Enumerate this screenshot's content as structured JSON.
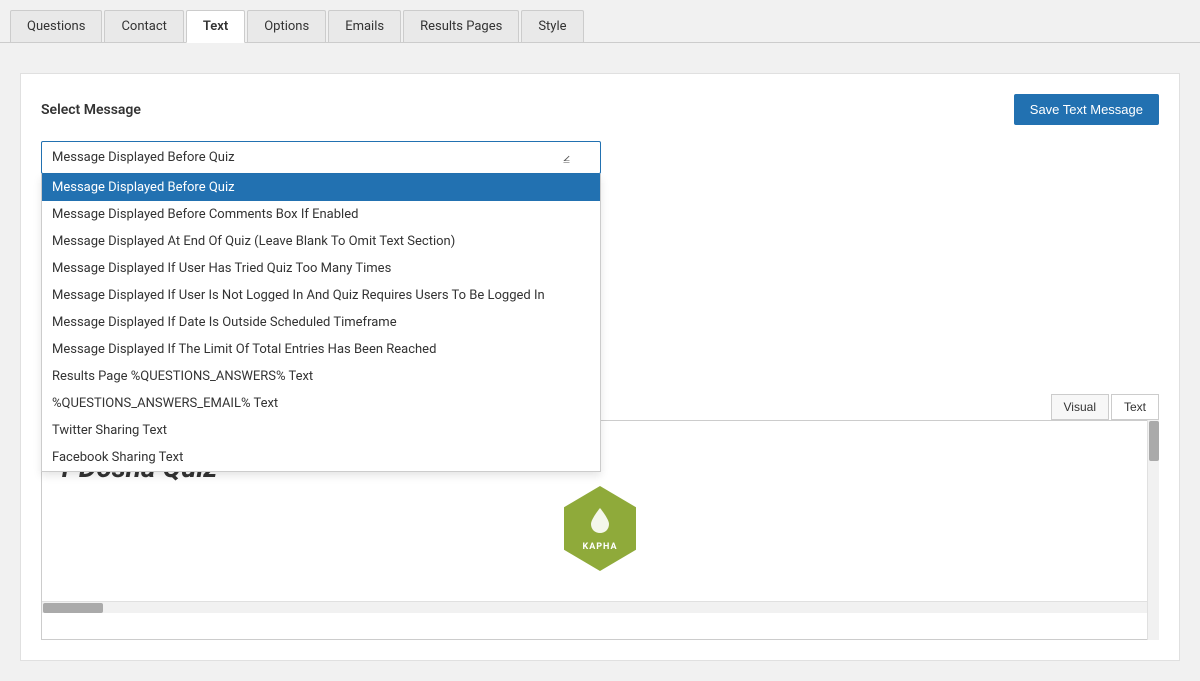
{
  "tabs": [
    {
      "id": "questions",
      "label": "Questions",
      "active": false
    },
    {
      "id": "contact",
      "label": "Contact",
      "active": false
    },
    {
      "id": "text",
      "label": "Text",
      "active": true
    },
    {
      "id": "options",
      "label": "Options",
      "active": false
    },
    {
      "id": "emails",
      "label": "Emails",
      "active": false
    },
    {
      "id": "results-pages",
      "label": "Results Pages",
      "active": false
    },
    {
      "id": "style",
      "label": "Style",
      "active": false
    }
  ],
  "section": {
    "label": "Select Message",
    "save_button": "Save Text Message"
  },
  "select": {
    "selected_value": "Message Displayed Before Quiz",
    "placeholder": "Message Displayed Before Quiz",
    "options": [
      {
        "id": "before-quiz",
        "label": "Message Displayed Before Quiz",
        "selected": true
      },
      {
        "id": "before-comments",
        "label": "Message Displayed Before Comments Box If Enabled",
        "selected": false
      },
      {
        "id": "end-of-quiz",
        "label": "Message Displayed At End Of Quiz (Leave Blank To Omit Text Section)",
        "selected": false
      },
      {
        "id": "too-many-times",
        "label": "Message Displayed If User Has Tried Quiz Too Many Times",
        "selected": false
      },
      {
        "id": "not-logged-in",
        "label": "Message Displayed If User Is Not Logged In And Quiz Requires Users To Be Logged In",
        "selected": false
      },
      {
        "id": "outside-timeframe",
        "label": "Message Displayed If Date Is Outside Scheduled Timeframe",
        "selected": false
      },
      {
        "id": "limit-reached",
        "label": "Message Displayed If The Limit Of Total Entries Has Been Reached",
        "selected": false
      },
      {
        "id": "results-answers-text",
        "label": "Results Page %QUESTIONS_ANSWERS% Text",
        "selected": false
      },
      {
        "id": "questions-answers-email",
        "label": "%QUESTIONS_ANSWERS_EMAIL% Text",
        "selected": false
      },
      {
        "id": "twitter-sharing",
        "label": "Twitter Sharing Text",
        "selected": false
      },
      {
        "id": "facebook-sharing",
        "label": "Facebook Sharing Text",
        "selected": false
      }
    ]
  },
  "editor": {
    "visual_tab": "Visual",
    "text_tab": "Text",
    "active_tab": "Text",
    "content_title": "r Dosha Quiz",
    "badge_text": "KAPHA"
  }
}
